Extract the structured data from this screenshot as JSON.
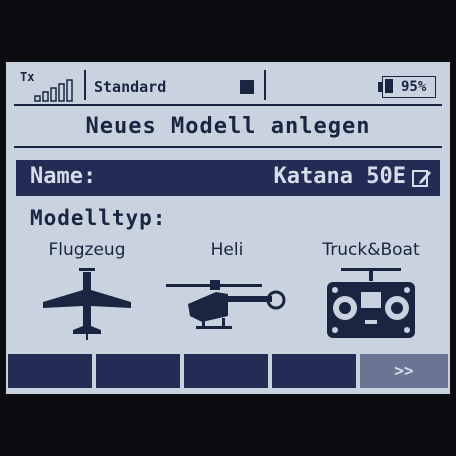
{
  "status": {
    "tx_label": "Tx",
    "model_name": "Standard",
    "battery_text": "95%"
  },
  "title": "Neues Modell anlegen",
  "name_row": {
    "label": "Name:",
    "value": "Katana 50E"
  },
  "model_type": {
    "label": "Modelltyp:",
    "options": [
      {
        "label": "Flugzeug",
        "icon": "airplane-icon"
      },
      {
        "label": "Heli",
        "icon": "helicopter-icon"
      },
      {
        "label": "Truck&Boat",
        "icon": "transmitter-icon"
      }
    ]
  },
  "softkeys": {
    "next_label": ">>"
  },
  "colors": {
    "screen": "#c9d3e0",
    "ink": "#1b2440",
    "highlight": "#232c55"
  }
}
